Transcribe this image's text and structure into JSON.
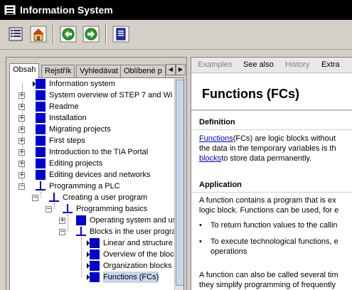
{
  "window": {
    "title": "Information System"
  },
  "toolbar": {
    "buttons": [
      {
        "icon": "contents-icon"
      },
      {
        "icon": "home-icon"
      },
      {
        "icon": "back-icon"
      },
      {
        "icon": "forward-icon"
      },
      {
        "icon": "print-icon"
      }
    ]
  },
  "left_tabs": [
    {
      "label": "Obsah",
      "active": true
    },
    {
      "label": "Rejstřík"
    },
    {
      "label": "Vyhledávat"
    },
    {
      "label": "Oblíbené p"
    }
  ],
  "tree": [
    {
      "label": "Information system",
      "level": 0,
      "icon": "page",
      "expander": ""
    },
    {
      "label": "System overview of STEP 7 and Wi",
      "level": 0,
      "icon": "book",
      "expander": "+"
    },
    {
      "label": "Readme",
      "level": 0,
      "icon": "book",
      "expander": "+"
    },
    {
      "label": "Installation",
      "level": 0,
      "icon": "book",
      "expander": "+"
    },
    {
      "label": "Migrating projects",
      "level": 0,
      "icon": "book",
      "expander": "+"
    },
    {
      "label": "First steps",
      "level": 0,
      "icon": "book",
      "expander": "+"
    },
    {
      "label": "Introduction to the TIA Portal",
      "level": 0,
      "icon": "book",
      "expander": "+"
    },
    {
      "label": "Editing projects",
      "level": 0,
      "icon": "book",
      "expander": "+"
    },
    {
      "label": "Editing devices and networks",
      "level": 0,
      "icon": "book",
      "expander": "+"
    },
    {
      "label": "Programming a PLC",
      "level": 0,
      "icon": "folder",
      "expander": "−"
    },
    {
      "label": "Creating a user program",
      "level": 1,
      "icon": "folder",
      "expander": "−"
    },
    {
      "label": "Programming basics",
      "level": 2,
      "icon": "folder",
      "expander": "−"
    },
    {
      "label": "Operating system and us",
      "level": 3,
      "icon": "book",
      "expander": "+"
    },
    {
      "label": "Blocks in the user progra",
      "level": 3,
      "icon": "folder",
      "expander": "−"
    },
    {
      "label": "Linear and structure",
      "level": 4,
      "icon": "page",
      "expander": ""
    },
    {
      "label": "Overview of the bloc",
      "level": 4,
      "icon": "page",
      "expander": ""
    },
    {
      "label": "Organization blocks",
      "level": 4,
      "icon": "page",
      "expander": ""
    },
    {
      "label": "Functions (FCs)",
      "level": 4,
      "icon": "page",
      "expander": "",
      "selected": true
    }
  ],
  "right_tabs": [
    {
      "label": "Examples",
      "dim": true
    },
    {
      "label": "See also",
      "dim": false
    },
    {
      "label": "History",
      "dim": true
    },
    {
      "label": "Extra",
      "dim": false
    }
  ],
  "article": {
    "title": "Functions (FCs)",
    "definition_heading": "Definition",
    "def_line1_link": "Functions",
    "def_line1_rest": "(FCs) are logic blocks without",
    "def_line2": "the data in the temporary variables is th",
    "def_line3_link": "blocks",
    "def_line3_rest": "to store data permanently.",
    "application_heading": "Application",
    "app_line1": "A function contains a program that is ex",
    "app_line2": "logic block. Functions can be used, for e",
    "bullet1": "To return function values to the callin",
    "bullet2_line1": "To execute technological functions, e",
    "bullet2_line2": "operations",
    "extra_line1": "A function can also be called several tim",
    "extra_line2": "they simplify programming of frequently"
  }
}
